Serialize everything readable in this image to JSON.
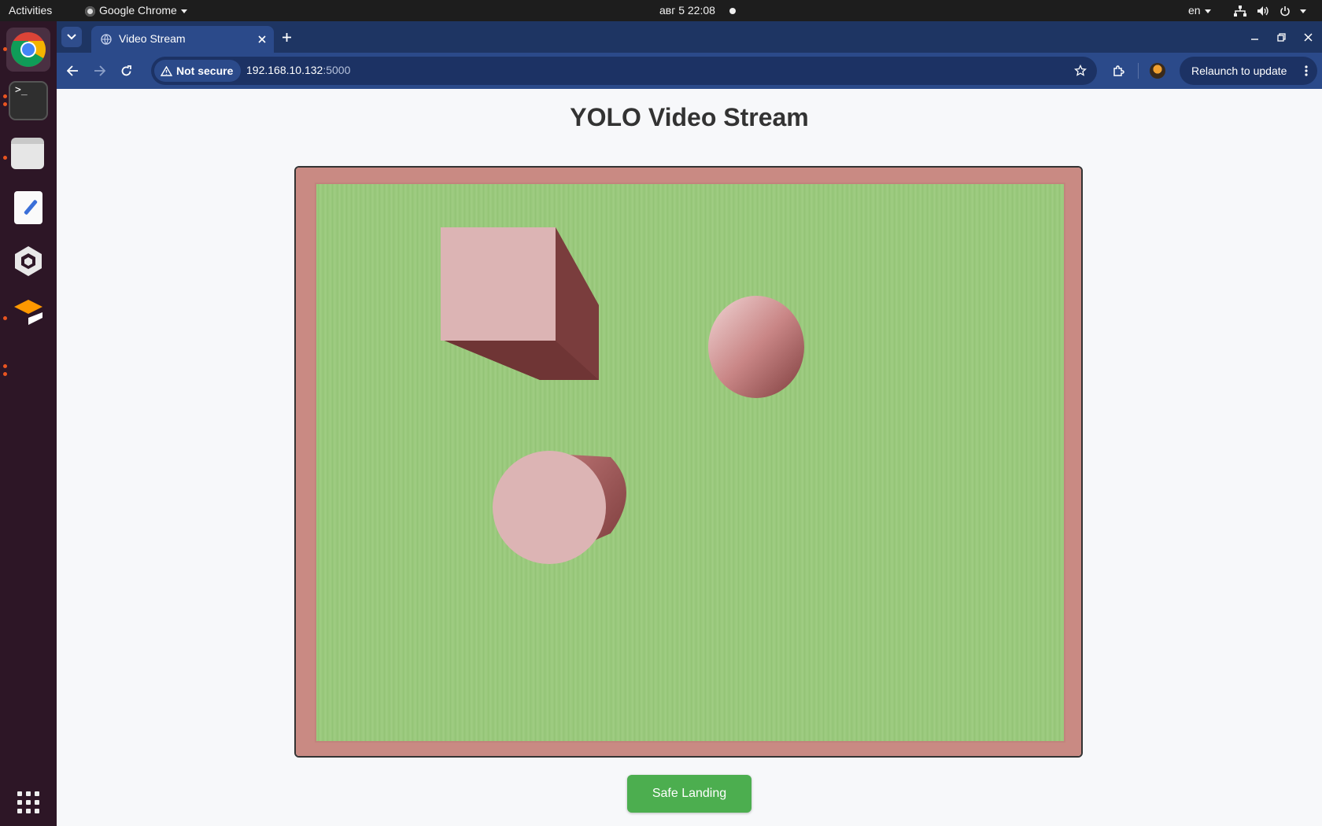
{
  "system_bar": {
    "activities": "Activities",
    "app_menu": "Google Chrome",
    "clock": "авг 5  22:08",
    "language": "en"
  },
  "dock": {
    "apps": [
      "chrome-icon",
      "terminal-icon",
      "files-icon",
      "text-editor-icon",
      "unity-icon",
      "sublime-icon"
    ],
    "show_apps_icon": "grid-icon"
  },
  "browser": {
    "tab_title": "Video Stream",
    "security_label": "Not secure",
    "url_host": "192.168.10.132",
    "url_port": ":5000",
    "relaunch_label": "Relaunch to update"
  },
  "page": {
    "title": "YOLO Video Stream",
    "landing_button": "Safe Landing"
  },
  "colors": {
    "topbar": "#1d1d1d",
    "dock": "#2d1626",
    "tabstrip": "#1e3563",
    "toolbar": "#2b4a8a",
    "button_green": "#4cae4f",
    "grass": "#96c87a",
    "object_pink": "#dcb4b4",
    "ubuntu_orange": "#e95420"
  }
}
